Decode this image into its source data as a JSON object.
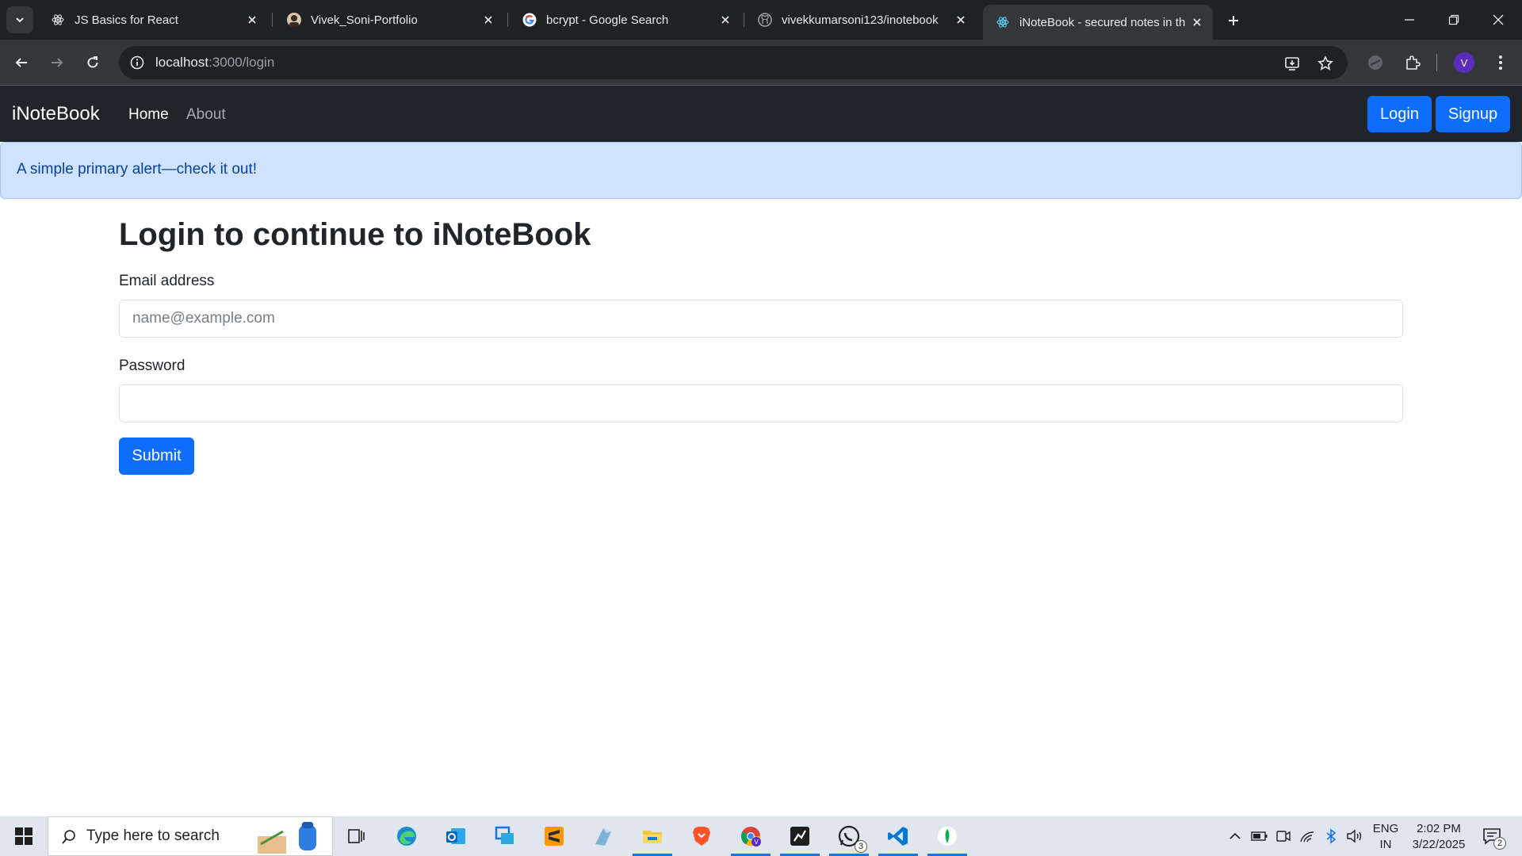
{
  "browser": {
    "tabs": [
      {
        "title": "JS Basics for React",
        "icon": "react-icon"
      },
      {
        "title": "Vivek_Soni-Portfolio",
        "icon": "portfolio-avatar-icon"
      },
      {
        "title": "bcrypt - Google Search",
        "icon": "google-icon"
      },
      {
        "title": "vivekkumarsoni123/inotebook",
        "icon": "github-icon"
      },
      {
        "title": "iNoteBook - secured notes in th",
        "icon": "react-icon",
        "active": true
      }
    ],
    "url_host": "localhost",
    "url_path": ":3000/login",
    "profile_initial": "V"
  },
  "navbar": {
    "brand": "iNoteBook",
    "links": [
      "Home",
      "About"
    ],
    "login_label": "Login",
    "signup_label": "Signup"
  },
  "alert": {
    "text": "A simple primary alert—check it out!"
  },
  "form": {
    "heading": "Login to continue to iNoteBook",
    "email_label": "Email address",
    "email_placeholder": "name@example.com",
    "email_value": "",
    "password_label": "Password",
    "password_value": "",
    "submit_label": "Submit"
  },
  "taskbar": {
    "search_placeholder": "Type here to search",
    "whatsapp_badge": "3",
    "lang_line1": "ENG",
    "lang_line2": "IN",
    "time": "2:02 PM",
    "date": "3/22/2025",
    "notification_count": "2"
  },
  "colors": {
    "primary": "#0d6efd",
    "navbar_bg": "#212529",
    "alert_bg": "#cfe2ff",
    "alert_text": "#084298"
  }
}
